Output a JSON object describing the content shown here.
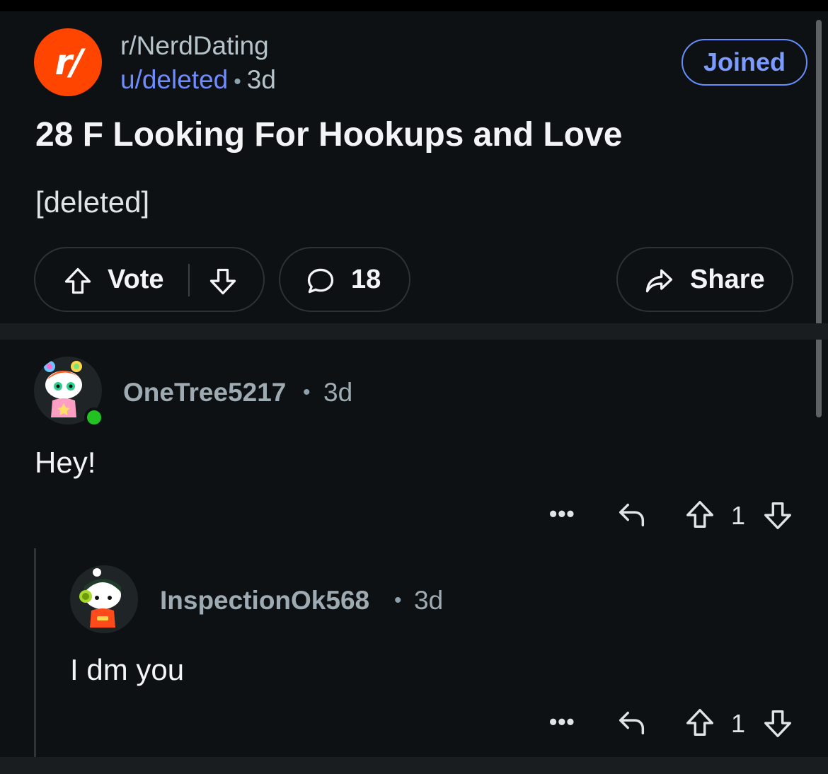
{
  "post": {
    "subreddit": "r/NerdDating",
    "subreddit_icon_text": "r/",
    "author": "u/deleted",
    "age": "3d",
    "joined_label": "Joined",
    "title": "28 F Looking For Hookups and Love",
    "body": "[deleted]",
    "vote_label": "Vote",
    "comment_count": "18",
    "share_label": "Share"
  },
  "comments": [
    {
      "username": "OneTree5217",
      "age": "3d",
      "text": "Hey!",
      "score": "1",
      "more": "•••"
    },
    {
      "username": "InspectionOk568",
      "age": "3d",
      "text": "I dm you",
      "score": "1",
      "more": "•••"
    }
  ],
  "separator_dot": "•",
  "colors": {
    "background": "#0e1113",
    "accent_orange": "#ff4500",
    "link_blue": "#6e8cff",
    "online_green": "#22c222"
  },
  "icons": [
    "upvote-icon",
    "downvote-icon",
    "comment-icon",
    "share-icon",
    "reply-icon",
    "more-icon"
  ]
}
